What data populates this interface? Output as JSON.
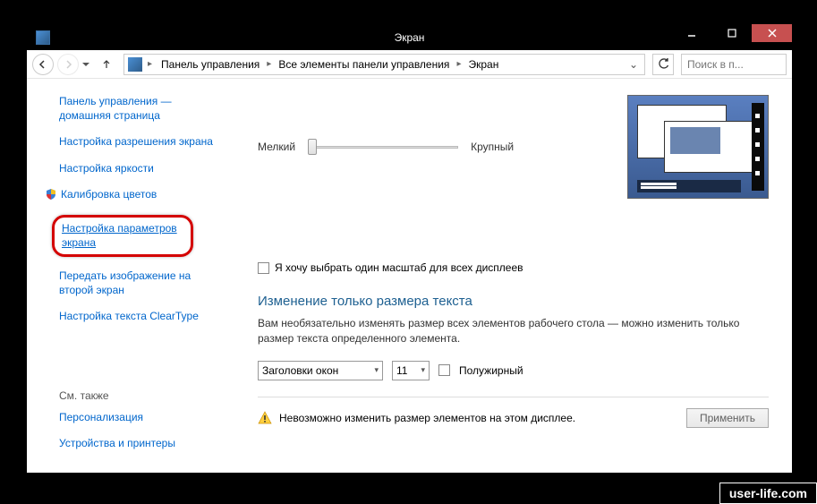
{
  "window": {
    "title": "Экран"
  },
  "toolbar": {
    "breadcrumb": [
      "Панель управления",
      "Все элементы панели управления",
      "Экран"
    ],
    "search_placeholder": "Поиск в п..."
  },
  "sidebar": {
    "links": {
      "home": "Панель управления — домашняя страница",
      "resolution": "Настройка разрешения экрана",
      "brightness": "Настройка яркости",
      "calibration": "Калибровка цветов",
      "screen_params": "Настройка параметров экрана",
      "project": "Передать изображение на второй экран",
      "cleartype": "Настройка текста ClearType"
    },
    "see_also": {
      "heading": "См. также",
      "personalization": "Персонализация",
      "devices": "Устройства и принтеры"
    }
  },
  "main": {
    "slider": {
      "min_label": "Мелкий",
      "max_label": "Крупный"
    },
    "scale_checkbox": "Я хочу выбрать один масштаб для всех дисплеев",
    "text_size": {
      "title": "Изменение только размера текста",
      "desc": "Вам необязательно изменять размер всех элементов рабочего стола — можно изменить только размер текста определенного элемента.",
      "element_select": "Заголовки окон",
      "size_select": "11",
      "bold_label": "Полужирный"
    },
    "warning": "Невозможно изменить размер элементов на этом дисплее.",
    "apply": "Применить"
  },
  "watermark": "user-life.com"
}
